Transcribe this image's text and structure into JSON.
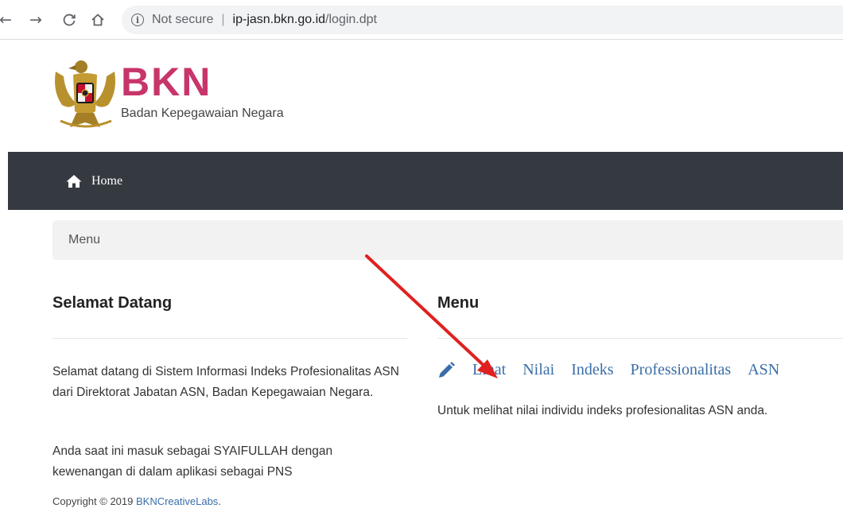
{
  "browser": {
    "back_icon": "arrow-left-icon",
    "forward_icon": "arrow-right-icon",
    "reload_icon": "reload-icon",
    "home_icon": "home-icon",
    "security_label": "Not secure",
    "url_host": "ip-jasn.bkn.go.id",
    "url_path": "/login.dpt"
  },
  "header": {
    "brand": "BKN",
    "subtitle": "Badan Kepegawaian Negara",
    "brand_color": "#c7356a"
  },
  "navbar": {
    "home_label": "Home"
  },
  "breadcrumb": {
    "label": "Menu"
  },
  "welcome": {
    "title": "Selamat Datang",
    "paragraph1": "Selamat datang di Sistem Informasi Indeks Profesionalitas ASN dari Direktorat Jabatan ASN, Badan Kepegawaian Negara.",
    "paragraph2": "Anda saat ini masuk sebagai SYAIFULLAH dengan kewenangan di dalam aplikasi sebagai PNS"
  },
  "menu": {
    "title": "Menu",
    "link_words": [
      "Lihat",
      "Nilai",
      "Indeks",
      "Professionalitas",
      "ASN"
    ],
    "link_description": "Untuk melihat nilai individu indeks profesionalitas ASN anda."
  },
  "footer": {
    "copyright_prefix": "Copyright © 2019 ",
    "copyright_link": "BKNCreativeLabs",
    "copyright_suffix": "."
  },
  "colors": {
    "navbar_bg": "#343a40",
    "link": "#3a6ea8",
    "annotation_arrow": "#e02020"
  }
}
